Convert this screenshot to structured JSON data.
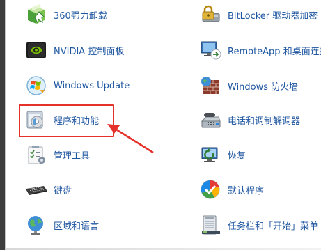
{
  "control_panel": {
    "left_items": [
      {
        "label": "360强力卸载",
        "icon": "uninstall-box-icon"
      },
      {
        "label": "NVIDIA 控制面板",
        "icon": "nvidia-icon"
      },
      {
        "label": "Windows Update",
        "icon": "windows-update-icon"
      },
      {
        "label": "程序和功能",
        "icon": "programs-features-icon"
      },
      {
        "label": "管理工具",
        "icon": "admin-tools-icon"
      },
      {
        "label": "键盘",
        "icon": "keyboard-icon"
      },
      {
        "label": "区域和语言",
        "icon": "region-language-icon"
      }
    ],
    "right_items": [
      {
        "label": "BitLocker 驱动器加密",
        "icon": "bitlocker-icon"
      },
      {
        "label": "RemoteApp 和桌面连接",
        "icon": "remoteapp-icon"
      },
      {
        "label": "Windows 防火墙",
        "icon": "firewall-icon"
      },
      {
        "label": "电话和调制解调器",
        "icon": "phone-modem-icon"
      },
      {
        "label": "恢复",
        "icon": "recovery-icon"
      },
      {
        "label": "默认程序",
        "icon": "default-programs-icon"
      },
      {
        "label": "任务栏和「开始」菜单",
        "icon": "taskbar-start-icon"
      }
    ]
  },
  "annotation": {
    "highlight_color": "#e4312a",
    "highlighted_item": "程序和功能"
  },
  "colors": {
    "link": "#1e56a0",
    "frame": "#3d3d3d"
  }
}
